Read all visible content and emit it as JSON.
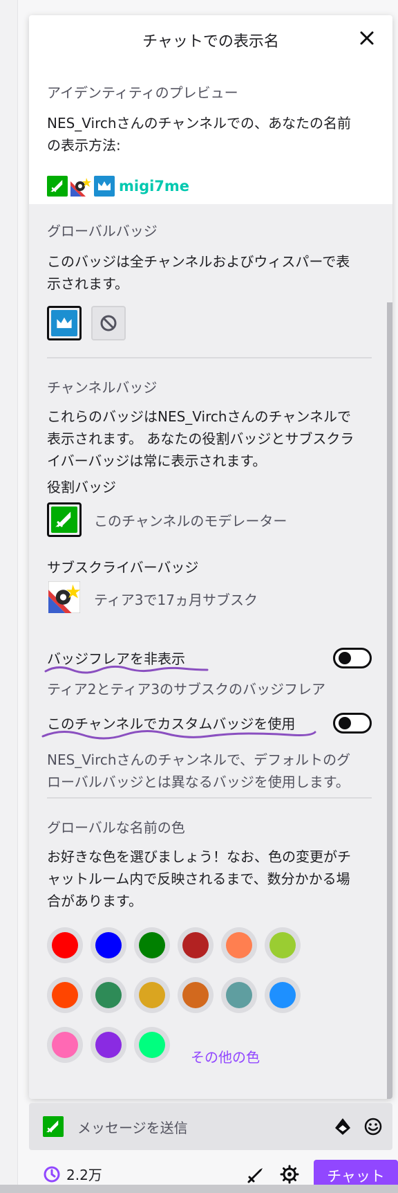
{
  "modal": {
    "title": "チャットでの表示名",
    "close_icon": "close-icon"
  },
  "preview": {
    "label": "アイデンティティのプレビュー",
    "desc_line1": "NES_Virchさんのチャンネルでの、あなたの名前",
    "desc_line2": "の表示方法:",
    "username": "migi7me",
    "username_color": "#00c8af"
  },
  "global_badge": {
    "label": "グローバルバッジ",
    "desc_line1": "このバッジは全チャンネルおよびウィスパーで表",
    "desc_line2": "示されます。"
  },
  "channel_badge": {
    "label": "チャンネルバッジ",
    "desc_line1": "これらのバッジはNES_Virchさんのチャンネルで",
    "desc_line2": "表示されます。 あなたの役割バッジとサブスクラ",
    "desc_line3": "イバーバッジは常に表示されます。",
    "role_label": "役割バッジ",
    "role_desc": "このチャンネルのモデレーター",
    "sub_label": "サブスクライバーバッジ",
    "sub_desc": "ティア3で17ヵ月サブスク"
  },
  "toggles": {
    "hide_flair_label": "バッジフレアを非表示",
    "hide_flair_desc": "ティア2とティア3のサブスクのバッジフレア",
    "custom_badge_label": "このチャンネルでカスタムバッジを使用",
    "custom_badge_desc_line1": "NES_Virchさんのチャンネルで、デフォルトのグ",
    "custom_badge_desc_line2": "ローバルバッジとは異なるバッジを使用します。"
  },
  "name_color": {
    "label": "グローバルな名前の色",
    "desc_line1": "お好きな色を選びましょう！なお、色の変更がチ",
    "desc_line2": "ャットルーム内で反映されるまで、数分かかる場",
    "desc_line3": "合があります。",
    "swatches": [
      "#ff0000",
      "#0000ff",
      "#008000",
      "#b22222",
      "#ff7f50",
      "#9acd32",
      "#ff4500",
      "#2e8b57",
      "#daa520",
      "#d2691e",
      "#5f9ea0",
      "#1e90ff",
      "#ff69b4",
      "#8a2be2",
      "#00ff7f"
    ],
    "other_colors": "その他の色"
  },
  "chat": {
    "placeholder": "メッセージを送信",
    "points": "2.2万",
    "chat_button": "チャット"
  },
  "colors": {
    "accent": "#9147ff",
    "moderator_green": "#00ad03",
    "prime_blue": "#1c8fd1"
  }
}
